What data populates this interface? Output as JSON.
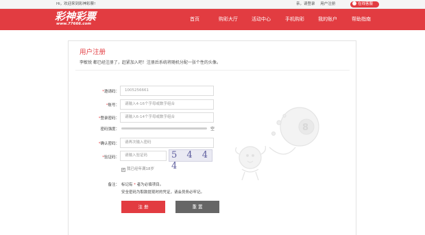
{
  "topbar": {
    "welcome": "Hi，欢迎来到彩神彩票!",
    "links": [
      "亲，请登录",
      "用户注册"
    ],
    "service_label": "在线客服",
    "service_icon": "phone-icon"
  },
  "logo": {
    "main": "彩神彩票",
    "url": "www.77666.com"
  },
  "nav": {
    "items": [
      "首页",
      "购彩大厅",
      "活动中心",
      "手机购彩",
      "我的账户",
      "帮助指南"
    ]
  },
  "page": {
    "title": "用户注册",
    "subtitle_name": "李敏锐",
    "subtitle_rest": " 都已经注册了，赶紧加入吧！注册后系统将随机分配一张个性的头像。"
  },
  "form": {
    "invite": {
      "label": "邀请码：",
      "required": "*",
      "value": "1005256661"
    },
    "account": {
      "label": "账号：",
      "required": "*",
      "placeholder": "请输入4-16个字母或数字组合"
    },
    "password": {
      "label": "登录密码：",
      "required": "*",
      "placeholder": "请输入6-14个字母或数字组合"
    },
    "strength": {
      "label": "密码强度：",
      "value_label": "空",
      "level": 0
    },
    "confirm": {
      "label": "确认密码：",
      "required": "*",
      "placeholder": "请再次输入密码"
    },
    "captcha": {
      "label": "验证码：",
      "required": "*",
      "placeholder": "请输入验证码",
      "image_text": "5 4 4 4"
    },
    "agree": {
      "label": "我已经年满18岁",
      "checked": true
    },
    "notes": {
      "label": "备注：",
      "line1_prefix": "标记有 ",
      "line1_star": "*",
      "line1_suffix": " 者为必填项目。",
      "line2": "安全密码为取款提现时的凭证，请会员务必牢记。"
    },
    "register_button": "注 册",
    "reset_button": "重 置"
  },
  "colors": {
    "brand": "#e23c41",
    "reset": "#666666"
  }
}
